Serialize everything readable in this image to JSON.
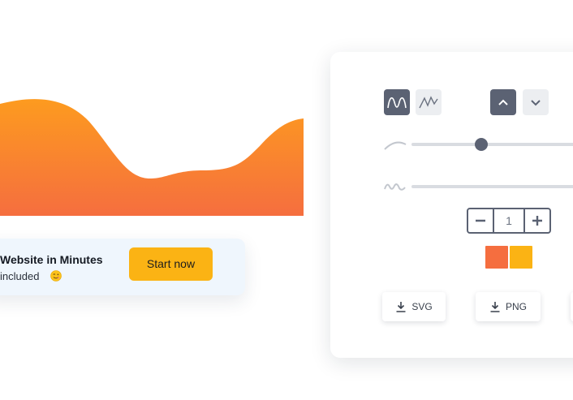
{
  "promo": {
    "title": "Website in Minutes",
    "subtitle": "included",
    "cta": "Start now"
  },
  "wave": {
    "gradient_top": "#fd9b1f",
    "gradient_bottom": "#f56e3f"
  },
  "controls": {
    "stepper": {
      "minus": "−",
      "value": "1",
      "plus": "+"
    },
    "colors": [
      "#f56e3f",
      "#fbb314"
    ],
    "downloads": {
      "svg": "SVG",
      "png": "PNG"
    },
    "accent": "#5b6273",
    "slider1_level_pct": 22
  }
}
